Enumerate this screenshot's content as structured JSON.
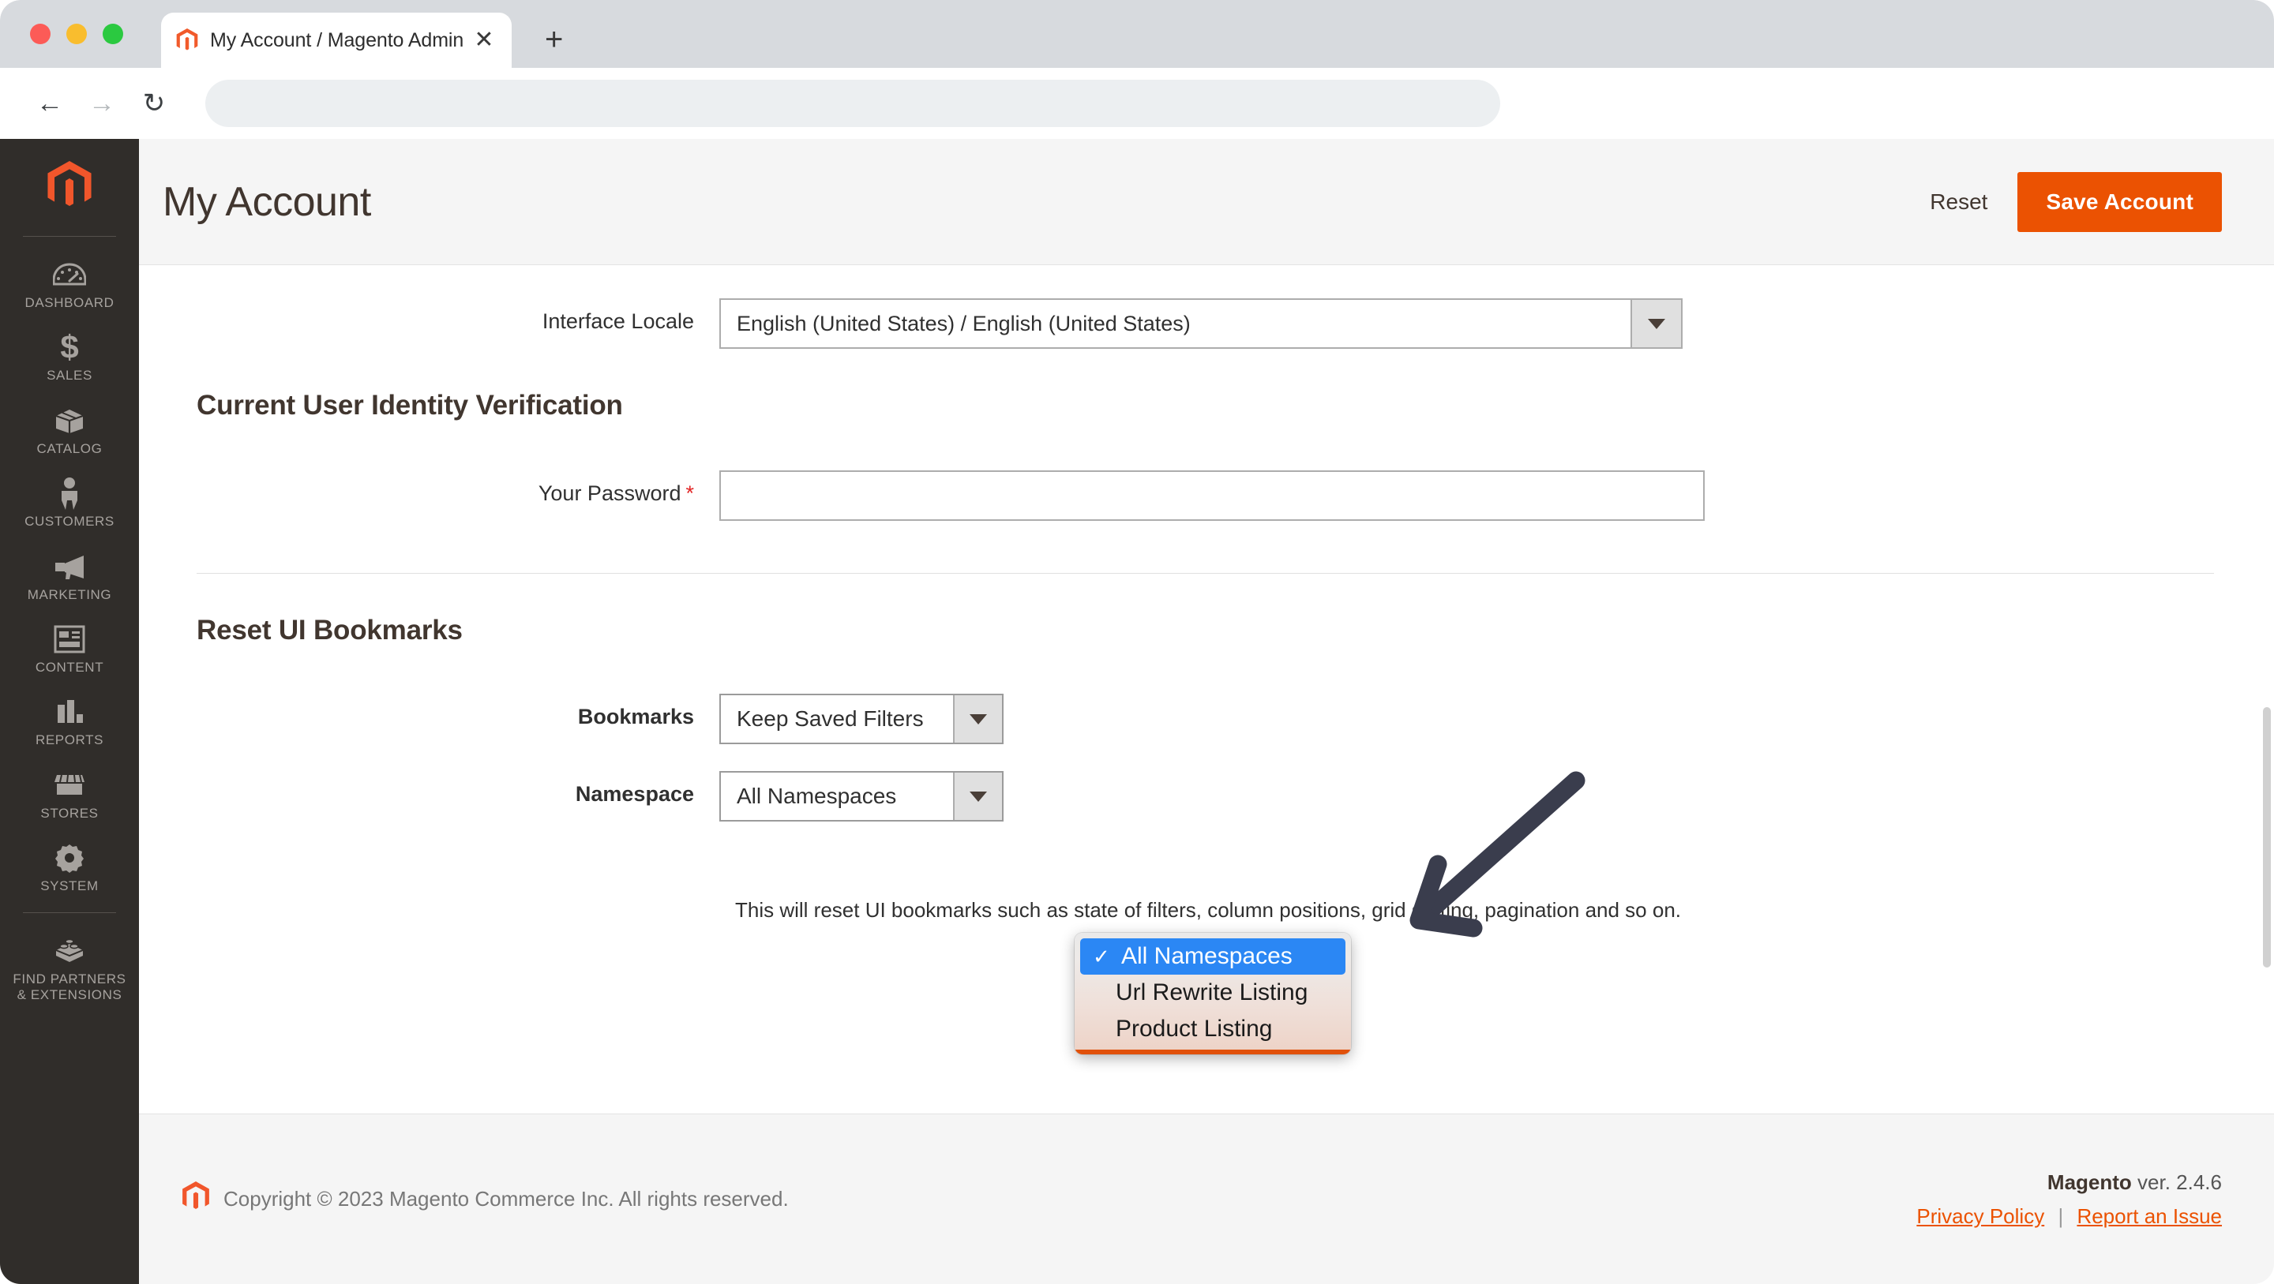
{
  "browser": {
    "tab": {
      "title": "My Account / Magento Admin",
      "favicon_icon": "magento-logo-icon",
      "close_icon": "close-icon"
    },
    "new_tab_icon": "plus-icon",
    "nav": {
      "back_icon": "arrow-left-icon",
      "forward_icon": "arrow-right-icon",
      "reload_icon": "reload-icon"
    },
    "address_bar": {
      "value": "",
      "placeholder": ""
    }
  },
  "sidebar": {
    "logo_icon": "magento-logo-icon",
    "items": [
      {
        "label": "Dashboard",
        "icon": "dashboard-gauge-icon"
      },
      {
        "label": "Sales",
        "icon": "dollar-sign-icon"
      },
      {
        "label": "Catalog",
        "icon": "box-icon"
      },
      {
        "label": "Customers",
        "icon": "person-icon"
      },
      {
        "label": "Marketing",
        "icon": "megaphone-icon"
      },
      {
        "label": "Content",
        "icon": "layout-page-icon"
      },
      {
        "label": "Reports",
        "icon": "bar-chart-icon"
      },
      {
        "label": "Stores",
        "icon": "storefront-icon"
      },
      {
        "label": "System",
        "icon": "gear-icon"
      },
      {
        "label": "Find Partners\n& Extensions",
        "icon": "extensions-blocks-icon"
      }
    ]
  },
  "header": {
    "title": "My Account",
    "reset_label": "Reset",
    "save_label": "Save Account"
  },
  "form": {
    "interface_locale": {
      "label": "Interface Locale",
      "value": "English (United States) / English (United States)",
      "caret_icon": "chevron-down-icon"
    },
    "identity_section": {
      "title": "Current User Identity Verification",
      "password": {
        "label": "Your Password",
        "required_marker": "*",
        "value": "",
        "placeholder": ""
      }
    },
    "bookmarks_section": {
      "title": "Reset UI Bookmarks",
      "bookmarks": {
        "label": "Bookmarks",
        "value": "Keep Saved Filters",
        "caret_icon": "chevron-down-icon"
      },
      "namespace": {
        "label": "Namespace",
        "value": "All Namespaces",
        "caret_icon": "chevron-down-icon",
        "options": [
          {
            "label": "All Namespaces",
            "selected": true,
            "check_icon": "checkmark-icon"
          },
          {
            "label": "Url Rewrite Listing",
            "selected": false
          },
          {
            "label": "Product Listing",
            "selected": false
          }
        ]
      },
      "help_text": "This will reset UI bookmarks such as state of filters, column positions, grid sorting, pagination and so on."
    }
  },
  "annotation": {
    "arrow_icon": "pointer-arrow-icon",
    "color": "#3a3d4d"
  },
  "footer": {
    "logo_icon": "magento-logo-icon",
    "copyright": "Copyright © 2023 Magento Commerce Inc. All rights reserved.",
    "version_brand": "Magento",
    "version_text": "ver. 2.4.6",
    "privacy_policy": "Privacy Policy",
    "separator": "|",
    "report_issue": "Report an Issue"
  },
  "colors": {
    "accent": "#eb5202",
    "sidebar_bg": "#302d2a",
    "highlight_blue": "#2b87f4"
  }
}
